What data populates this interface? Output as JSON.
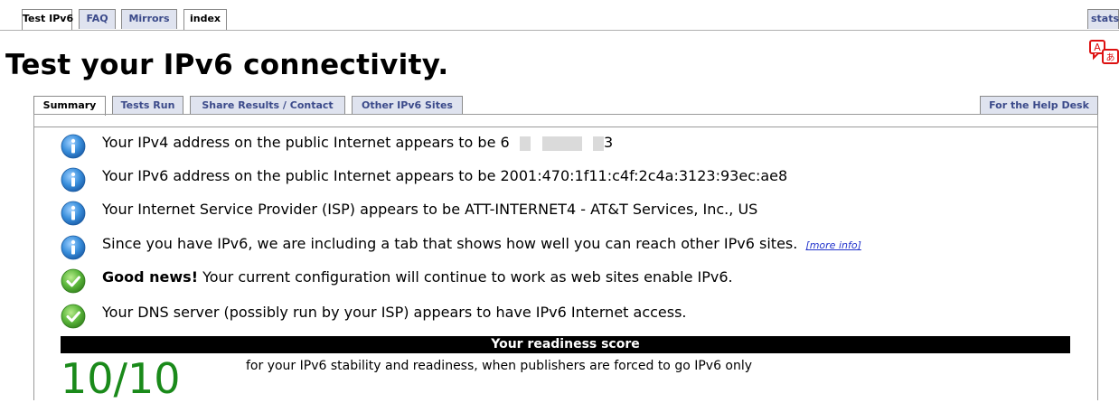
{
  "top_tabs": [
    {
      "label": "Test IPv6",
      "active": true
    },
    {
      "label": "FAQ",
      "active": false
    },
    {
      "label": "Mirrors",
      "active": false
    },
    {
      "label": "index",
      "active": false
    }
  ],
  "top_right_tab": "stats",
  "page_title": "Test your IPv6 connectivity.",
  "inner_tabs": [
    {
      "label": "Summary",
      "active": true
    },
    {
      "label": "Tests Run",
      "active": false
    },
    {
      "label": "Share Results / Contact",
      "active": false
    },
    {
      "label": "Other IPv6 Sites",
      "active": false
    }
  ],
  "help_desk_tab": "For the Help Desk",
  "results": [
    {
      "icon": "info-icon",
      "text": "Your IPv4 address on the public Internet appears to be 6",
      "suffix": "3"
    },
    {
      "icon": "info-icon",
      "text": "Your IPv6 address on the public Internet appears to be 2001:470:1f11:c4f:2c4a:3123:93ec:ae8"
    },
    {
      "icon": "info-icon",
      "text": "Your Internet Service Provider (ISP) appears to be ATT-INTERNET4 - AT&T Services, Inc., US"
    },
    {
      "icon": "info-icon",
      "text": "Since you have IPv6, we are including a tab that shows how well you can reach other IPv6 sites.",
      "link": "[more info]"
    },
    {
      "icon": "check-icon",
      "bold": "Good news!",
      "text": " Your current configuration will continue to work as web sites enable IPv6."
    },
    {
      "icon": "check-icon",
      "text": "Your DNS server (possibly run by your ISP) appears to have IPv6 Internet access."
    }
  ],
  "score": {
    "heading": "Your readiness score",
    "value": "10/10",
    "description": "for your IPv6 stability and readiness, when publishers are forced to go IPv6 only"
  },
  "colors": {
    "tab_bg": "#dfe3ef",
    "tab_text": "#3b4a8a",
    "info_blue": "#2f86d6",
    "check_green": "#55b03a",
    "score_green": "#1a8a1a"
  }
}
